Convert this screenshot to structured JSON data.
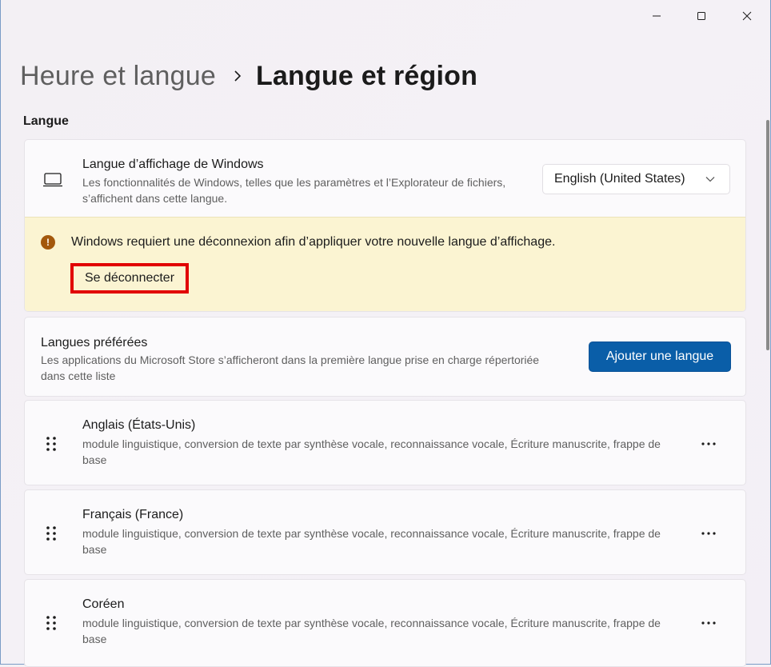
{
  "window": {
    "minimize_icon": "minimize-icon",
    "maximize_icon": "maximize-icon",
    "close_icon": "close-icon"
  },
  "breadcrumb": {
    "parent": "Heure et langue",
    "separator_icon": "chevron-right-icon",
    "current": "Langue et région"
  },
  "section": {
    "title": "Langue"
  },
  "display_language": {
    "icon": "monitor-icon",
    "title": "Langue d’affichage de Windows",
    "description": "Les fonctionnalités de Windows, telles que les paramètres et l’Explorateur de fichiers, s’affichent dans cette langue.",
    "selected": "English (United States)",
    "dropdown_icon": "chevron-down-icon"
  },
  "warning": {
    "icon": "warning-icon",
    "text": "Windows requiert une déconnexion afin d’appliquer votre nouvelle langue d’affichage.",
    "button_label": "Se déconnecter"
  },
  "preferred": {
    "title": "Langues préférées",
    "description": "Les applications du Microsoft Store s’afficheront dans la première langue prise en charge répertoriée dans cette liste",
    "add_button": "Ajouter une langue"
  },
  "languages": [
    {
      "name": "Anglais (États-Unis)",
      "features": "module linguistique, conversion de texte par synthèse vocale, reconnaissance vocale, Écriture manuscrite, frappe de base"
    },
    {
      "name": "Français (France)",
      "features": "module linguistique, conversion de texte par synthèse vocale, reconnaissance vocale, Écriture manuscrite, frappe de base"
    },
    {
      "name": "Coréen",
      "features": "module linguistique, conversion de texte par synthèse vocale, reconnaissance vocale, Écriture manuscrite, frappe de base"
    }
  ],
  "colors": {
    "accent": "#0a5ea8",
    "warning_background": "#fbf4d2",
    "warning_icon": "#a3580c",
    "highlight_border": "#e10000"
  }
}
